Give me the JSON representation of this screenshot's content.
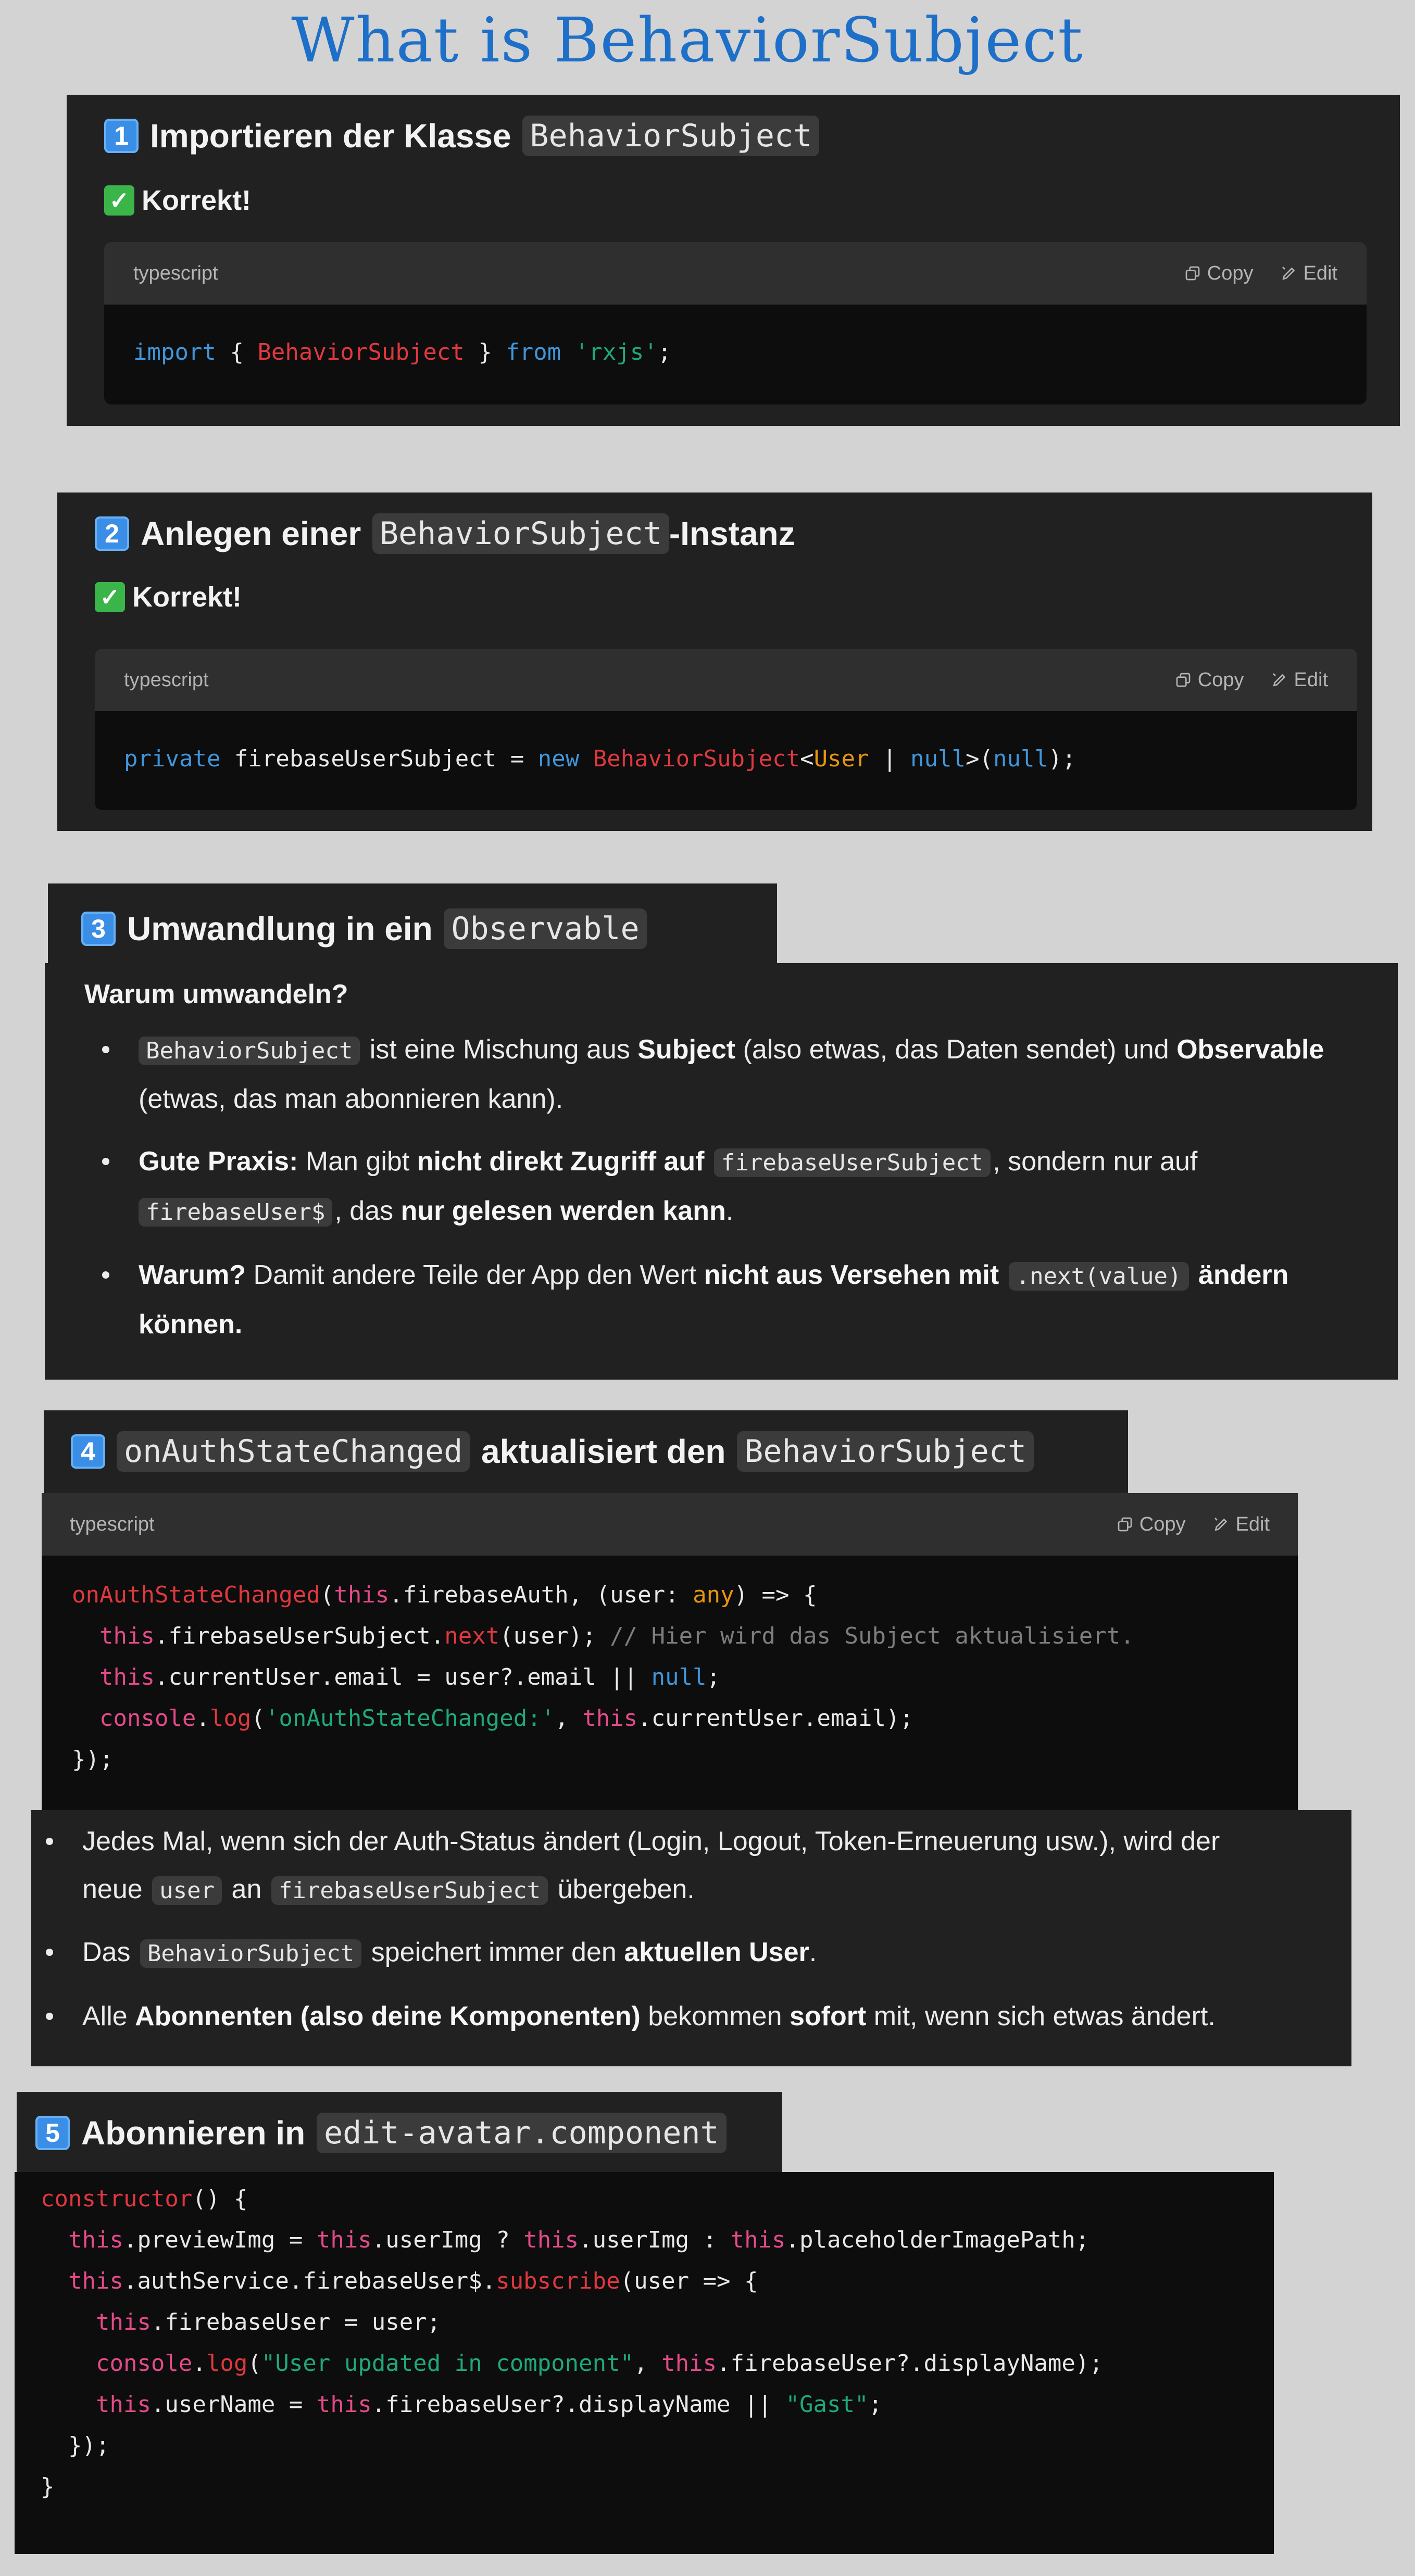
{
  "page_title": "What is BehaviorSubject",
  "ui": {
    "code_lang": "typescript",
    "copy_label": "Copy",
    "edit_label": "Edit",
    "correct_label": "Korrekt!"
  },
  "section1": {
    "number": "1",
    "heading_text": "Importieren der Klasse",
    "heading_code": "BehaviorSubject"
  },
  "section2": {
    "number": "2",
    "heading_text": "Anlegen einer",
    "heading_code": "BehaviorSubject",
    "heading_suffix": "-Instanz"
  },
  "section3": {
    "number": "3",
    "heading_text": "Umwandlung in ein",
    "heading_code": "Observable",
    "subheading": "Warum umwandeln?",
    "b1": {
      "code": "BehaviorSubject",
      "t1": " ist eine Mischung aus ",
      "b_subject": "Subject",
      "t2": " (also etwas, das Daten sendet) und ",
      "b_observable": "Observable",
      "t3": "(etwas, das man abonnieren kann)."
    },
    "b2": {
      "bold1": "Gute Praxis:",
      "t1": " Man gibt ",
      "bold2": "nicht direkt Zugriff auf",
      "code1": "firebaseUserSubject",
      "t2": ", sondern nur auf",
      "code2": "firebaseUser$",
      "t3": ", das ",
      "bold3": "nur gelesen werden kann",
      "t4": "."
    },
    "b3": {
      "bold1": "Warum?",
      "t1": " Damit andere Teile der App den Wert ",
      "bold2": "nicht aus Versehen mit",
      "code": ".next(value)",
      "bold3": "ändern",
      "bold4": "können."
    }
  },
  "section4": {
    "number": "4",
    "heading_code1": "onAuthStateChanged",
    "heading_text": "aktualisiert den",
    "heading_code2": "BehaviorSubject",
    "b1": {
      "t1": "Jedes Mal, wenn sich der Auth-Status ändert (Login, Logout, Token-Erneuerung usw.), wird der",
      "t2": "neue ",
      "code1": "user",
      "t3": " an ",
      "code2": "firebaseUserSubject",
      "t4": " übergeben."
    },
    "b2": {
      "t1": "Das ",
      "code": "BehaviorSubject",
      "t2": " speichert immer den ",
      "bold": "aktuellen User",
      "t3": "."
    },
    "b3": {
      "t1": "Alle ",
      "bold1": "Abonnenten (also deine Komponenten)",
      "t2": " bekommen ",
      "bold2": "sofort",
      "t3": " mit, wenn sich etwas ändert."
    }
  },
  "section5": {
    "number": "5",
    "heading_text": "Abonnieren in",
    "heading_code": "edit-avatar.component"
  },
  "colors": {
    "title": "#1d6fc8",
    "panel": "#212121",
    "code_bg": "#0d0d0d",
    "keyword": "#3f96dc",
    "class": "#e0383f",
    "string": "#1fa97a"
  },
  "icons": [
    "keycap-number-icon",
    "check-mark-icon",
    "copy-icon",
    "edit-icon"
  ]
}
